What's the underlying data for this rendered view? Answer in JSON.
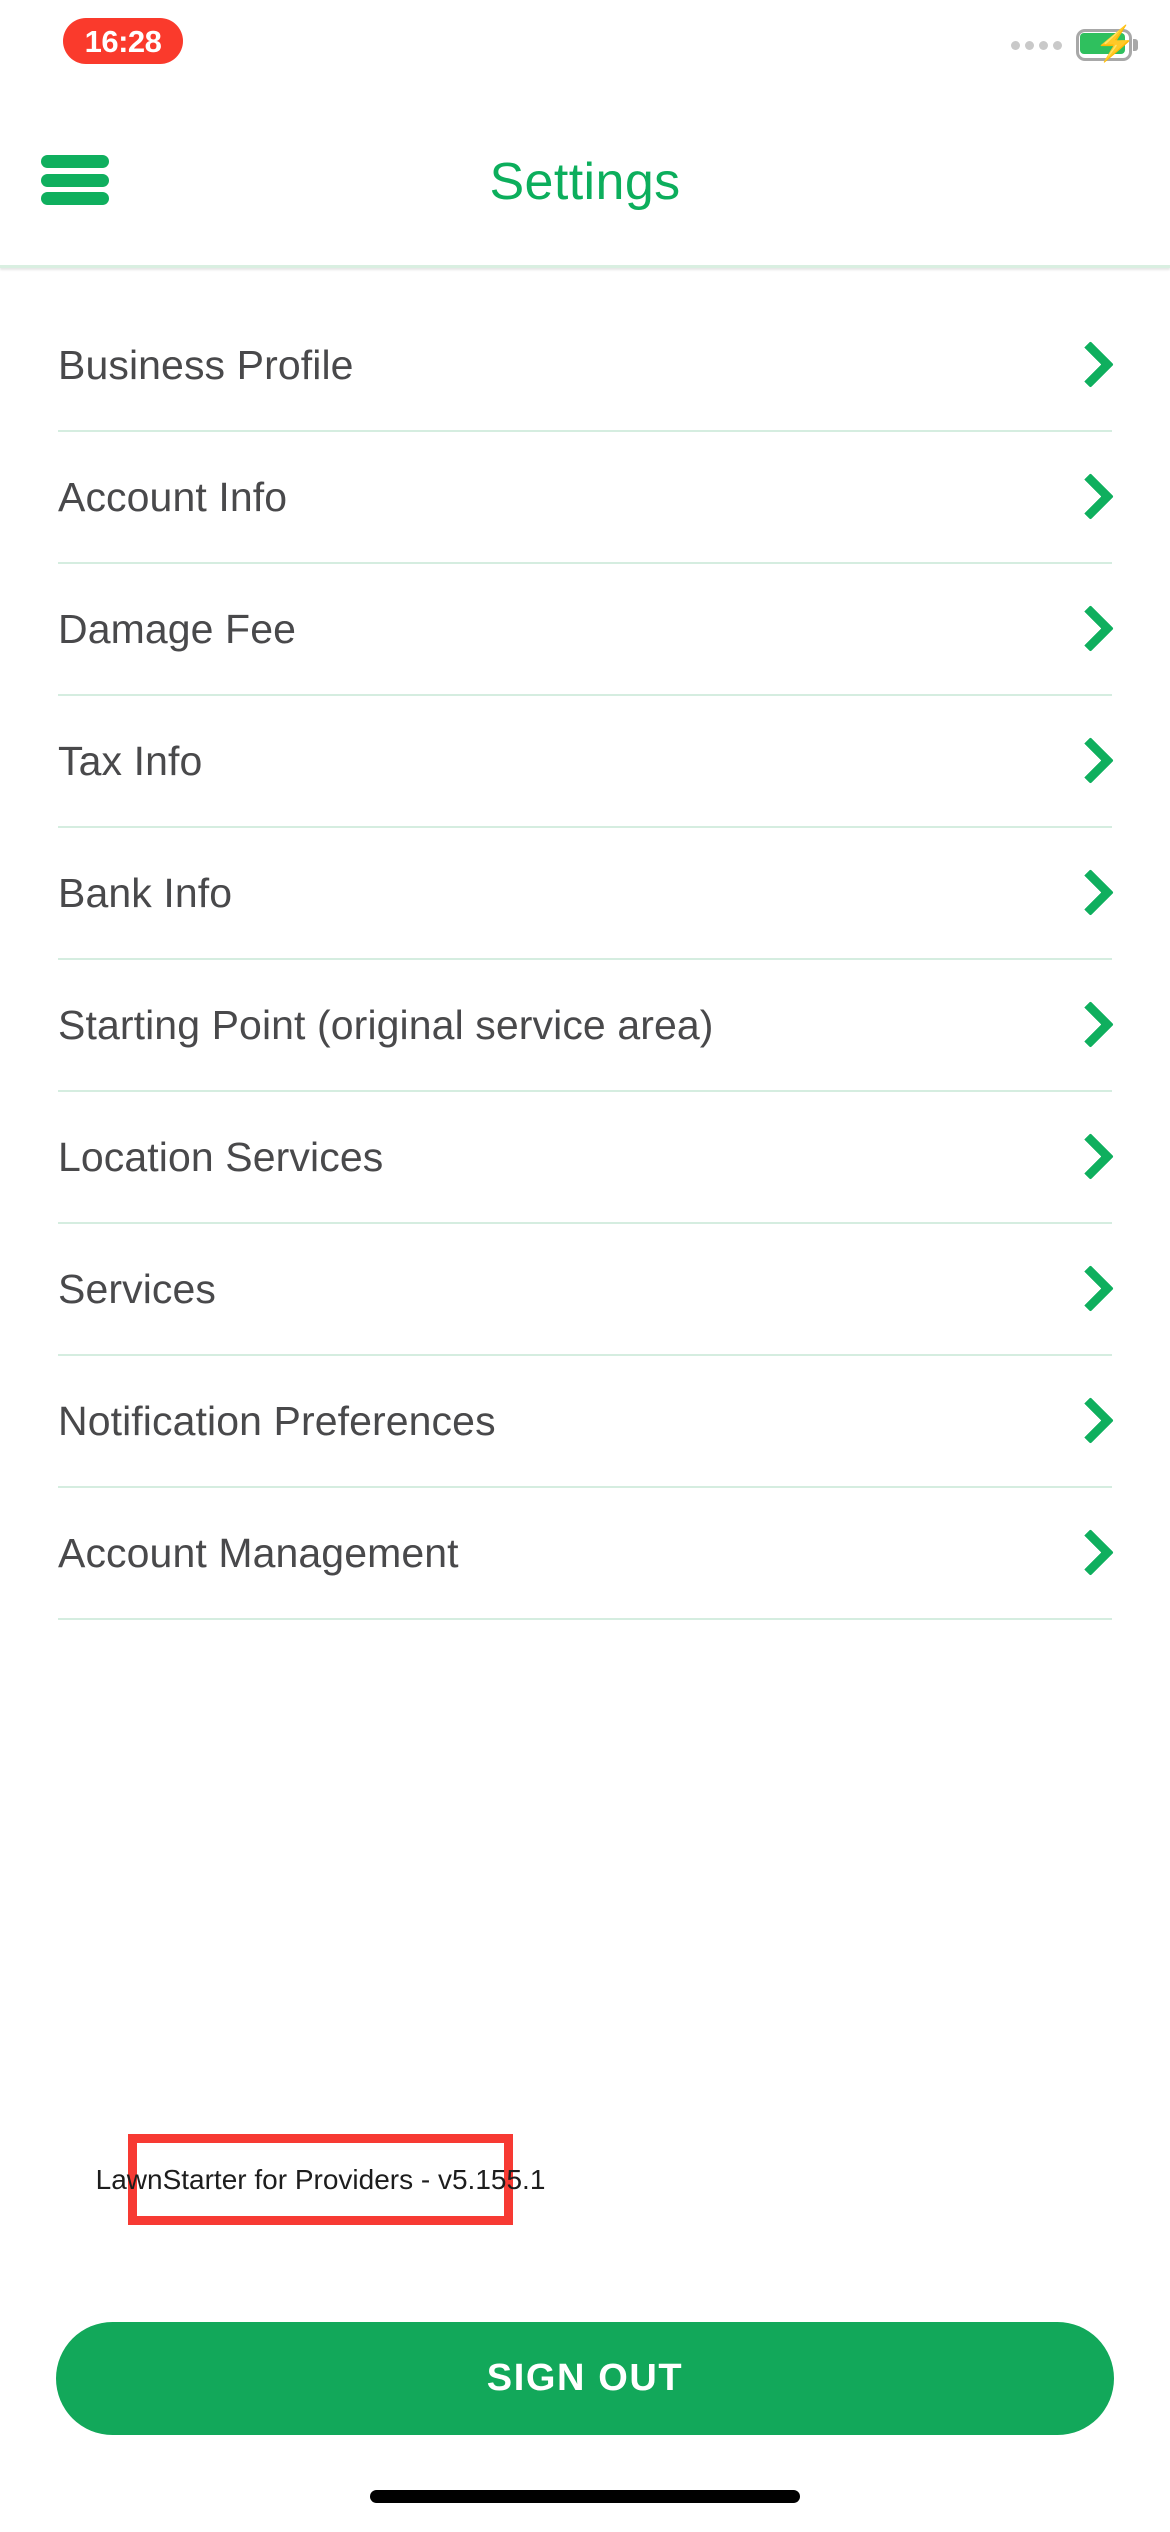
{
  "status_bar": {
    "time": "16:28",
    "time_pill_color": "#FA3A2C",
    "signal_dots_count": 4,
    "battery_icon": "battery-charging-icon",
    "battery_color": "#2FC05E",
    "charging": true
  },
  "header": {
    "menu_icon": "hamburger-menu-icon",
    "title": "Settings",
    "title_color": "#0CAE5C"
  },
  "settings_list": {
    "chevron_icon": "chevron-right-icon",
    "chevron_color": "#0FAF5E",
    "divider_color": "#D5EDE0",
    "items": [
      {
        "label": "Business Profile"
      },
      {
        "label": "Account Info"
      },
      {
        "label": "Damage Fee"
      },
      {
        "label": "Tax Info"
      },
      {
        "label": "Bank Info"
      },
      {
        "label": "Starting Point (original service area)"
      },
      {
        "label": "Location Services"
      },
      {
        "label": "Services"
      },
      {
        "label": "Notification Preferences"
      },
      {
        "label": "Account Management"
      }
    ]
  },
  "version_annotation": {
    "text": "LawnStarter for Providers - v5.155.1",
    "highlight_color": "#F73A33"
  },
  "footer": {
    "sign_out_label": "SIGN OUT",
    "sign_out_color": "#12A85A"
  }
}
